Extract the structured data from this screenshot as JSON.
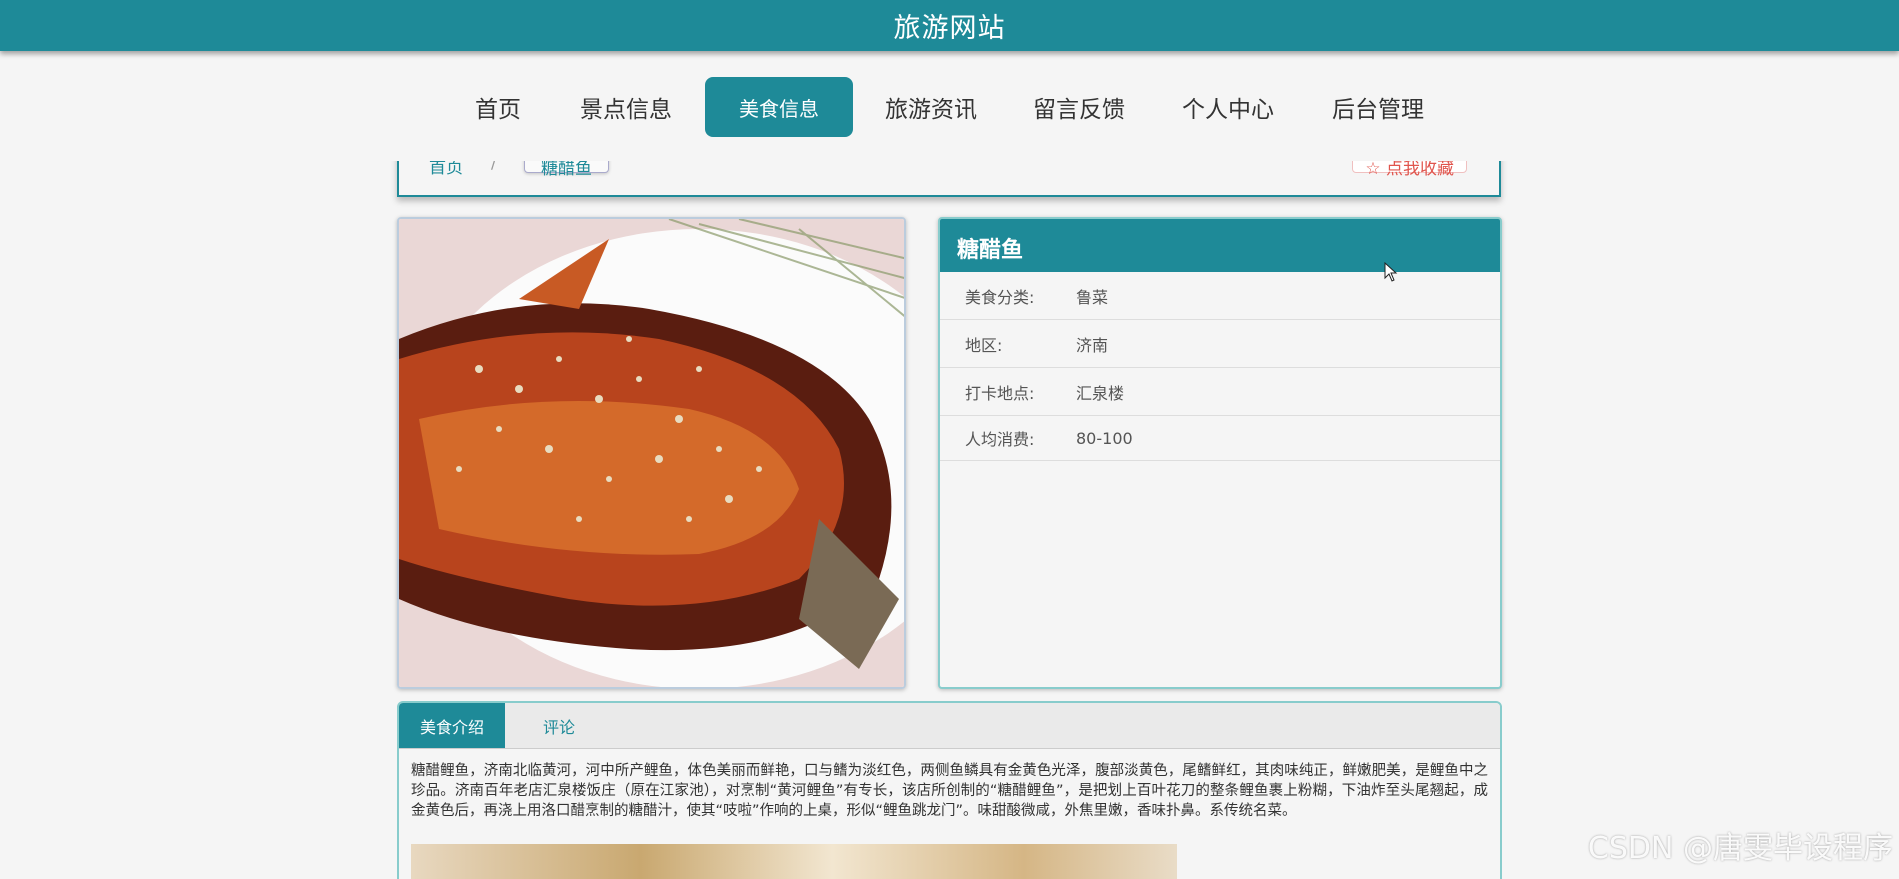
{
  "header": {
    "site_title": "旅游网站"
  },
  "nav": {
    "items": [
      {
        "label": "首页"
      },
      {
        "label": "景点信息"
      },
      {
        "label": "美食信息",
        "active": true
      },
      {
        "label": "旅游资讯"
      },
      {
        "label": "留言反馈"
      },
      {
        "label": "个人中心"
      },
      {
        "label": "后台管理"
      }
    ]
  },
  "breadcrumb": {
    "home": "首页",
    "separator": "/",
    "current": "糖醋鱼"
  },
  "favorite": {
    "label": "☆ 点我收藏"
  },
  "food": {
    "name": "糖醋鱼",
    "fields": [
      {
        "key": "美食分类:",
        "value": "鲁菜"
      },
      {
        "key": "地区:",
        "value": "济南"
      },
      {
        "key": "打卡地点:",
        "value": "汇泉楼"
      },
      {
        "key": "人均消费:",
        "value": "80-100"
      }
    ]
  },
  "tabs": [
    {
      "label": "美食介绍",
      "active": true
    },
    {
      "label": "评论"
    }
  ],
  "description": "糖醋鲤鱼，济南北临黄河，河中所产鲤鱼，体色美丽而鲜艳，口与鳍为淡红色，两侧鱼鳞具有金黄色光泽，腹部淡黄色，尾鳍鲜红，其肉味纯正，鲜嫩肥美，是鲤鱼中之珍品。济南百年老店汇泉楼饭庄（原在江家池），对烹制“黄河鲤鱼”有专长，该店所创制的“糖醋鲤鱼”，是把划上百叶花刀的整条鲤鱼裹上粉糊，下油炸至头尾翘起，成金黄色后，再浇上用洛口醋烹制的糖醋汁，使其“吱啦”作响的上桌，形似“鲤鱼跳龙门”。味甜酸微咸，外焦里嫩，香味扑鼻。系传统名菜。",
  "watermark": "CSDN @唐雯毕设程序",
  "colors": {
    "accent": "#1e8a98",
    "favorite": "#e0554d"
  }
}
